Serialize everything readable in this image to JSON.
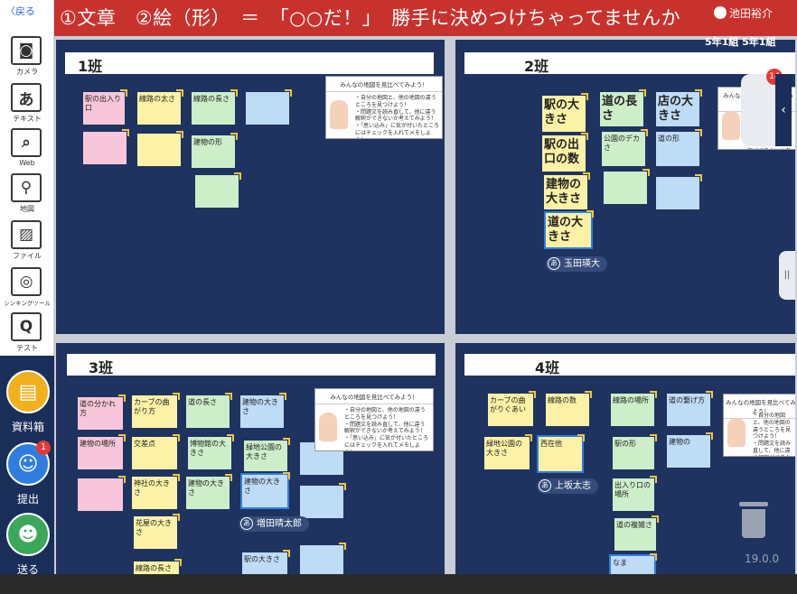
{
  "sidebar": {
    "back_label": "〈戻る",
    "tools": [
      {
        "label": "カメラ",
        "icon": "camera-icon",
        "glyph": "◙"
      },
      {
        "label": "テキスト",
        "icon": "text-icon",
        "glyph": "あ"
      },
      {
        "label": "Web",
        "icon": "web-search-icon",
        "glyph": "⌕"
      },
      {
        "label": "地図",
        "icon": "map-icon",
        "glyph": "⚲"
      },
      {
        "label": "ファイル",
        "icon": "file-image-icon",
        "glyph": "▨"
      },
      {
        "label": "シンキングツール",
        "icon": "thinking-tool-icon",
        "glyph": "◎"
      },
      {
        "label": "テスト",
        "icon": "test-icon",
        "glyph": "Q"
      }
    ],
    "actions": [
      {
        "label": "資料箱",
        "icon": "document-box-icon",
        "color": "#f2b01e",
        "glyph": "▤"
      },
      {
        "label": "提出",
        "icon": "submit-icon",
        "color": "#2f7de1",
        "glyph": "☺",
        "badge": "1"
      },
      {
        "label": "送る",
        "icon": "send-icon",
        "color": "#3aa858",
        "glyph": "☻"
      }
    ]
  },
  "topbar": {
    "prompt": "①文章　②絵（形）　＝　「○○だ！」　勝手に決めつけちゃってませんか",
    "user_name": "池田裕介",
    "class_label": "5年1組 5年1組",
    "unread_count": "14"
  },
  "board": {
    "panels": [
      {
        "title": "1班",
        "notes": [
          "駅の出入り口",
          "線路の太さ",
          "線路の長さ",
          "",
          "",
          "",
          "建物の形",
          ""
        ]
      },
      {
        "title": "2班",
        "notes": [
          "駅の大きさ",
          "道の長さ",
          "店の大きさ",
          "駅の出口の数",
          "公園のデカさ",
          "道の形",
          "建物の大きさ",
          "",
          "",
          "道の大きさ"
        ],
        "user": "玉田瑛大"
      },
      {
        "title": "3班",
        "notes": [
          "道の分かれ方",
          "カーブの曲がり方",
          "道の長さ",
          "建物の大きさ",
          "建物の場所",
          "交差点",
          "博物館の大きさ",
          "緑地公園の大きさ",
          "",
          "",
          "神社の大きさ",
          "建物の大きさ",
          "建物の大きさ",
          "",
          "花屋の大きさ",
          "駅の大きさ",
          "",
          "線路の長さ"
        ],
        "user": "増田晴太郎"
      },
      {
        "title": "4班",
        "notes": [
          "カーブの曲がりぐあい",
          "線路の数",
          "線路の場所",
          "道の繋げ方",
          "緑地公園の大きさ",
          "西在他",
          "駅の形",
          "建物の",
          "出入り口の場所",
          "道の複雑さ",
          "なま"
        ],
        "user": "上坂太志"
      }
    ],
    "card": {
      "heading": "みんなの地図を見比べてみよう！",
      "lines": [
        "・自分の地図と、他の地図の違うところを見つけよう！",
        "・問題文を読み直して、他に違う解釈ができないか考えてみよう！",
        "・「思い込み」に気が付いたところにはチェックを入れてメモしよう！"
      ]
    }
  },
  "version": "19.0.0"
}
